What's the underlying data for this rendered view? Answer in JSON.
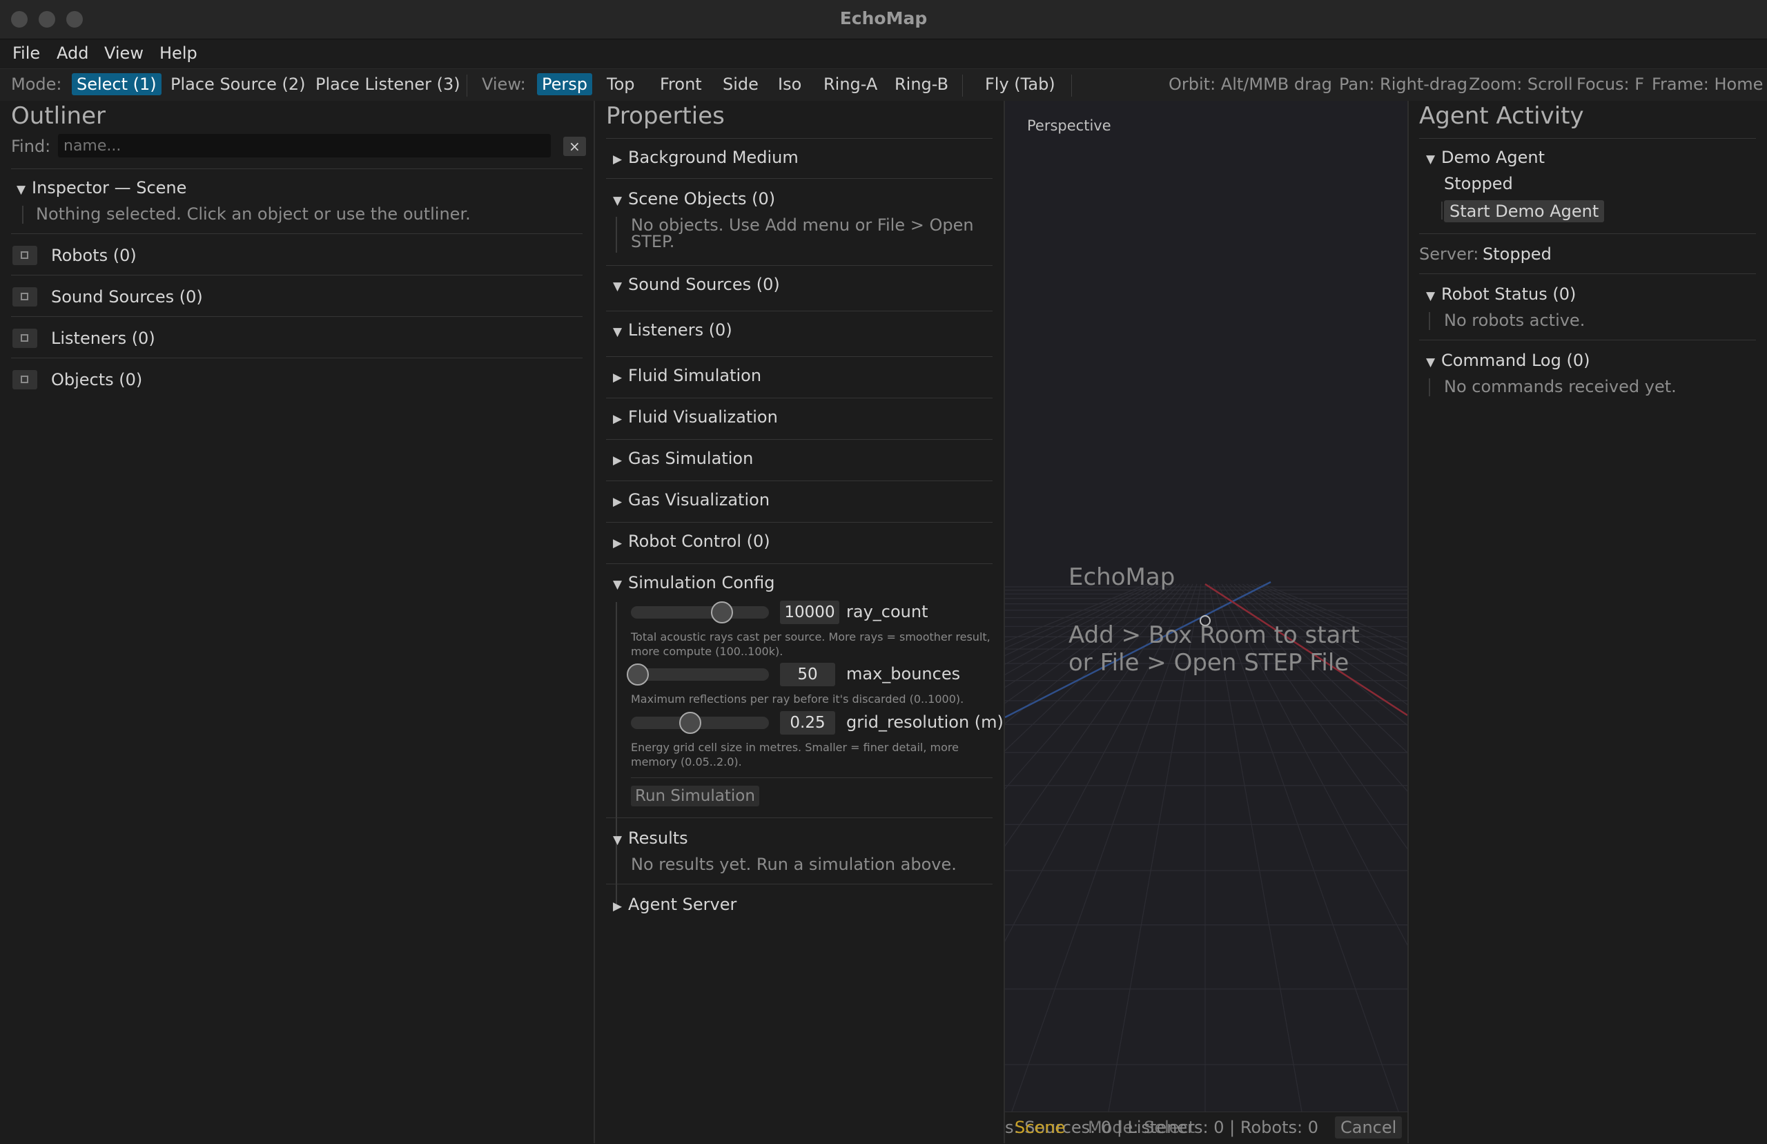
{
  "window": {
    "title": "EchoMap"
  },
  "menu": {
    "file": "File",
    "add": "Add",
    "view": "View",
    "help": "Help"
  },
  "toolbar": {
    "mode_label": "Mode:",
    "mode_select": "Select (1)",
    "mode_place_source": "Place Source (2)",
    "mode_place_listener": "Place Listener (3)",
    "view_label": "View:",
    "view_persp": "Persp",
    "view_top": "Top",
    "view_front": "Front",
    "view_side": "Side",
    "view_iso": "Iso",
    "view_ring_a": "Ring-A",
    "view_ring_b": "Ring-B",
    "fly": "Fly (Tab)",
    "hint_orbit": "Orbit: Alt/MMB drag",
    "hint_pan": "Pan: Right-drag",
    "hint_zoom": "Zoom: Scroll",
    "hint_focus": "Focus: F",
    "hint_frame": "Frame: Home"
  },
  "outliner": {
    "title": "Outliner",
    "find_label": "Find:",
    "find_placeholder": "name...",
    "clear": "×",
    "inspector_title": "Inspector — Scene",
    "inspector_empty": "Nothing selected. Click an object or use the outliner.",
    "robots": "Robots (0)",
    "sound_sources": "Sound Sources (0)",
    "listeners": "Listeners (0)",
    "objects": "Objects (0)"
  },
  "properties": {
    "title": "Properties",
    "background_medium": "Background Medium",
    "scene_objects": "Scene Objects (0)",
    "scene_objects_empty_1": "No objects. Use Add menu or File > Open",
    "scene_objects_empty_2": "STEP.",
    "sound_sources": "Sound Sources (0)",
    "listeners": "Listeners (0)",
    "fluid_simulation": "Fluid Simulation",
    "fluid_visualization": "Fluid Visualization",
    "gas_simulation": "Gas Simulation",
    "gas_visualization": "Gas Visualization",
    "robot_control": "Robot Control (0)",
    "simulation_config": "Simulation Config",
    "ray_count_value": "10000",
    "ray_count_label": "ray_count",
    "ray_count_fraction": 0.66,
    "ray_count_desc_1": "Total acoustic rays cast per source. More rays = smoother result,",
    "ray_count_desc_2": "more compute (100..100k).",
    "max_bounces_value": "50",
    "max_bounces_label": "max_bounces",
    "max_bounces_fraction": 0.05,
    "max_bounces_desc": "Maximum reflections per ray before it's discarded (0..1000).",
    "grid_resolution_value": "0.25",
    "grid_resolution_label": "grid_resolution (m)",
    "grid_resolution_fraction": 0.43,
    "grid_resolution_desc_1": "Energy grid cell size in metres. Smaller = finer detail, more",
    "grid_resolution_desc_2": "memory (0.05..2.0).",
    "run_simulation": "Run Simulation",
    "results": "Results",
    "results_empty": "No results yet. Run a simulation above.",
    "agent_server": "Agent Server"
  },
  "viewport": {
    "label": "Perspective",
    "app_name": "EchoMap",
    "hint_1": "Add > Box Room  to start",
    "hint_2": "or  File > Open STEP File"
  },
  "statusbar": {
    "text_behind": "s: Sources: 0 | Listeners: 0 | Robots: 0",
    "scene": "Scene",
    "mode": "Mode: Select",
    "cancel": "Cancel"
  },
  "agent": {
    "title": "Agent Activity",
    "demo_agent": "Demo Agent",
    "status": "Stopped",
    "start_button": "Start Demo Agent",
    "server_label": "Server:",
    "server_status": "Stopped",
    "robot_status": "Robot Status (0)",
    "no_robots": "No robots active.",
    "command_log": "Command Log (0)",
    "no_commands": "No commands received yet."
  },
  "colors": {
    "accent": "#0d5f86",
    "background": "#1c1c1c",
    "viewport_bg": "#1f1f24",
    "axis_x": "#8a2a35",
    "axis_z": "#2f4f8a"
  }
}
